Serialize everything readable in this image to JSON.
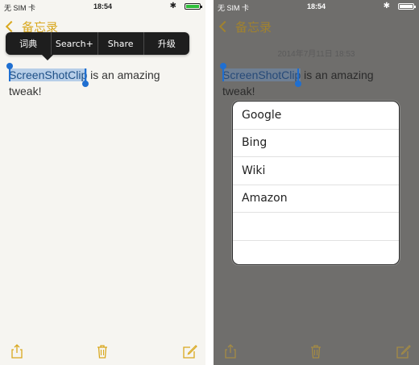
{
  "statusbar": {
    "carrier": "无 SIM 卡",
    "time": "18:54",
    "bluetooth": "✱"
  },
  "nav": {
    "back_label": "备忘录"
  },
  "popup_menu": {
    "items": [
      "词典",
      "Search+",
      "Share",
      "升级"
    ]
  },
  "note": {
    "selected": "ScreenShotClip",
    "rest": " is an amazing tweak!"
  },
  "right_screen": {
    "date": "2014年7月11日 18:53",
    "search_options": [
      "Google",
      "Bing",
      "Wiki",
      "Amazon"
    ]
  },
  "colors": {
    "accent": "#d9a81e",
    "selection_handle": "#1f6fd1",
    "selection_bg": "#b7cee8"
  },
  "icons": {
    "share": "share-icon",
    "trash": "trash-icon",
    "compose": "compose-icon"
  }
}
